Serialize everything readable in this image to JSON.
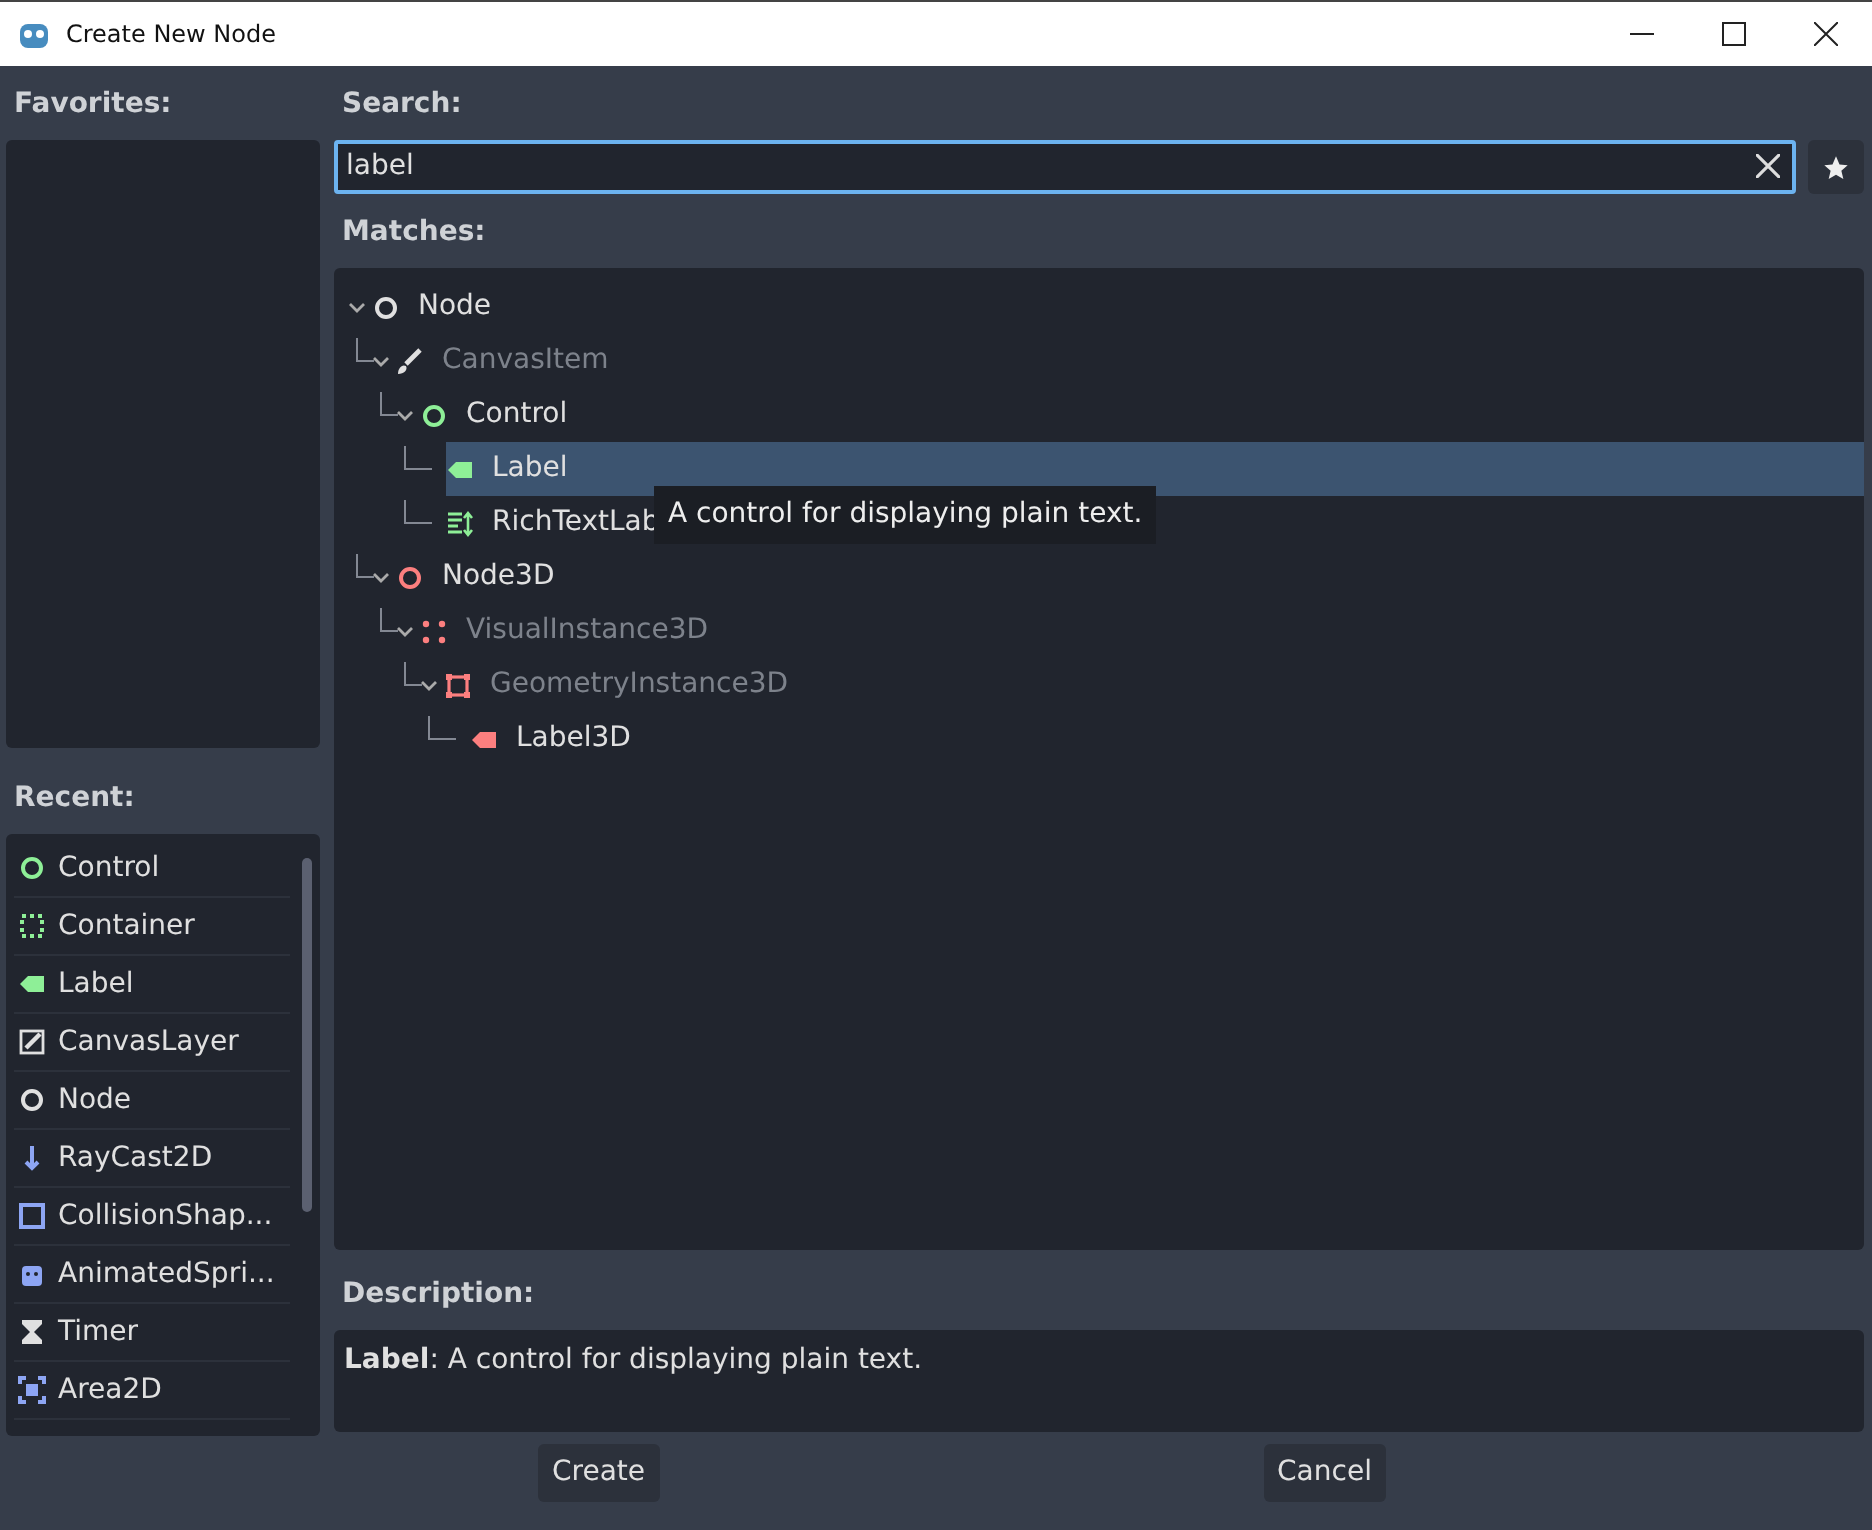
{
  "window": {
    "title": "Create New Node"
  },
  "favorites": {
    "label": "Favorites:"
  },
  "recent": {
    "label": "Recent:",
    "items": [
      {
        "name": "Control",
        "kind": "ring",
        "color": "#8eef97"
      },
      {
        "name": "Container",
        "kind": "dotted",
        "color": "#8eef97"
      },
      {
        "name": "Label",
        "kind": "tag",
        "color": "#8eef97"
      },
      {
        "name": "CanvasLayer",
        "kind": "layer",
        "color": "#e0e0e0"
      },
      {
        "name": "Node",
        "kind": "ring",
        "color": "#e0e0e0"
      },
      {
        "name": "RayCast2D",
        "kind": "ray",
        "color": "#8da5f3"
      },
      {
        "name": "CollisionShap...",
        "kind": "square",
        "color": "#8da5f3"
      },
      {
        "name": "AnimatedSpri...",
        "kind": "sprite",
        "color": "#8da5f3"
      },
      {
        "name": "Timer",
        "kind": "hourglass",
        "color": "#e0e0e0"
      },
      {
        "name": "Area2D",
        "kind": "area",
        "color": "#8da5f3"
      }
    ]
  },
  "search": {
    "label": "Search:",
    "value": "label"
  },
  "matches": {
    "label": "Matches:",
    "tree": [
      {
        "name": "Node",
        "kind": "ring",
        "color": "#e0e0e0",
        "disabled": false,
        "selected": false,
        "expanded": true,
        "children": [
          {
            "name": "CanvasItem",
            "kind": "brush",
            "color": "#e0e0e0",
            "disabled": true,
            "selected": false,
            "expanded": true,
            "children": [
              {
                "name": "Control",
                "kind": "ring",
                "color": "#8eef97",
                "disabled": false,
                "selected": false,
                "expanded": true,
                "children": [
                  {
                    "name": "Label",
                    "kind": "tag",
                    "color": "#8eef97",
                    "disabled": false,
                    "selected": true
                  },
                  {
                    "name": "RichTextLab",
                    "kind": "richtext",
                    "color": "#8eef97",
                    "disabled": false,
                    "selected": false
                  }
                ]
              }
            ]
          },
          {
            "name": "Node3D",
            "kind": "ring",
            "color": "#fc7f7f",
            "disabled": false,
            "selected": false,
            "expanded": true,
            "children": [
              {
                "name": "VisualInstance3D",
                "kind": "dots",
                "color": "#fc7f7f",
                "disabled": true,
                "selected": false,
                "expanded": true,
                "children": [
                  {
                    "name": "GeometryInstance3D",
                    "kind": "frame",
                    "color": "#fc7f7f",
                    "disabled": true,
                    "selected": false,
                    "expanded": true,
                    "children": [
                      {
                        "name": "Label3D",
                        "kind": "tag",
                        "color": "#fc7f7f",
                        "disabled": false,
                        "selected": false
                      }
                    ]
                  }
                ]
              }
            ]
          }
        ]
      }
    ],
    "tooltip": "A control for displaying plain text."
  },
  "description": {
    "label": "Description:",
    "text": "**Label**: A control for displaying plain text."
  },
  "buttons": [
    "Create",
    "Cancel"
  ]
}
